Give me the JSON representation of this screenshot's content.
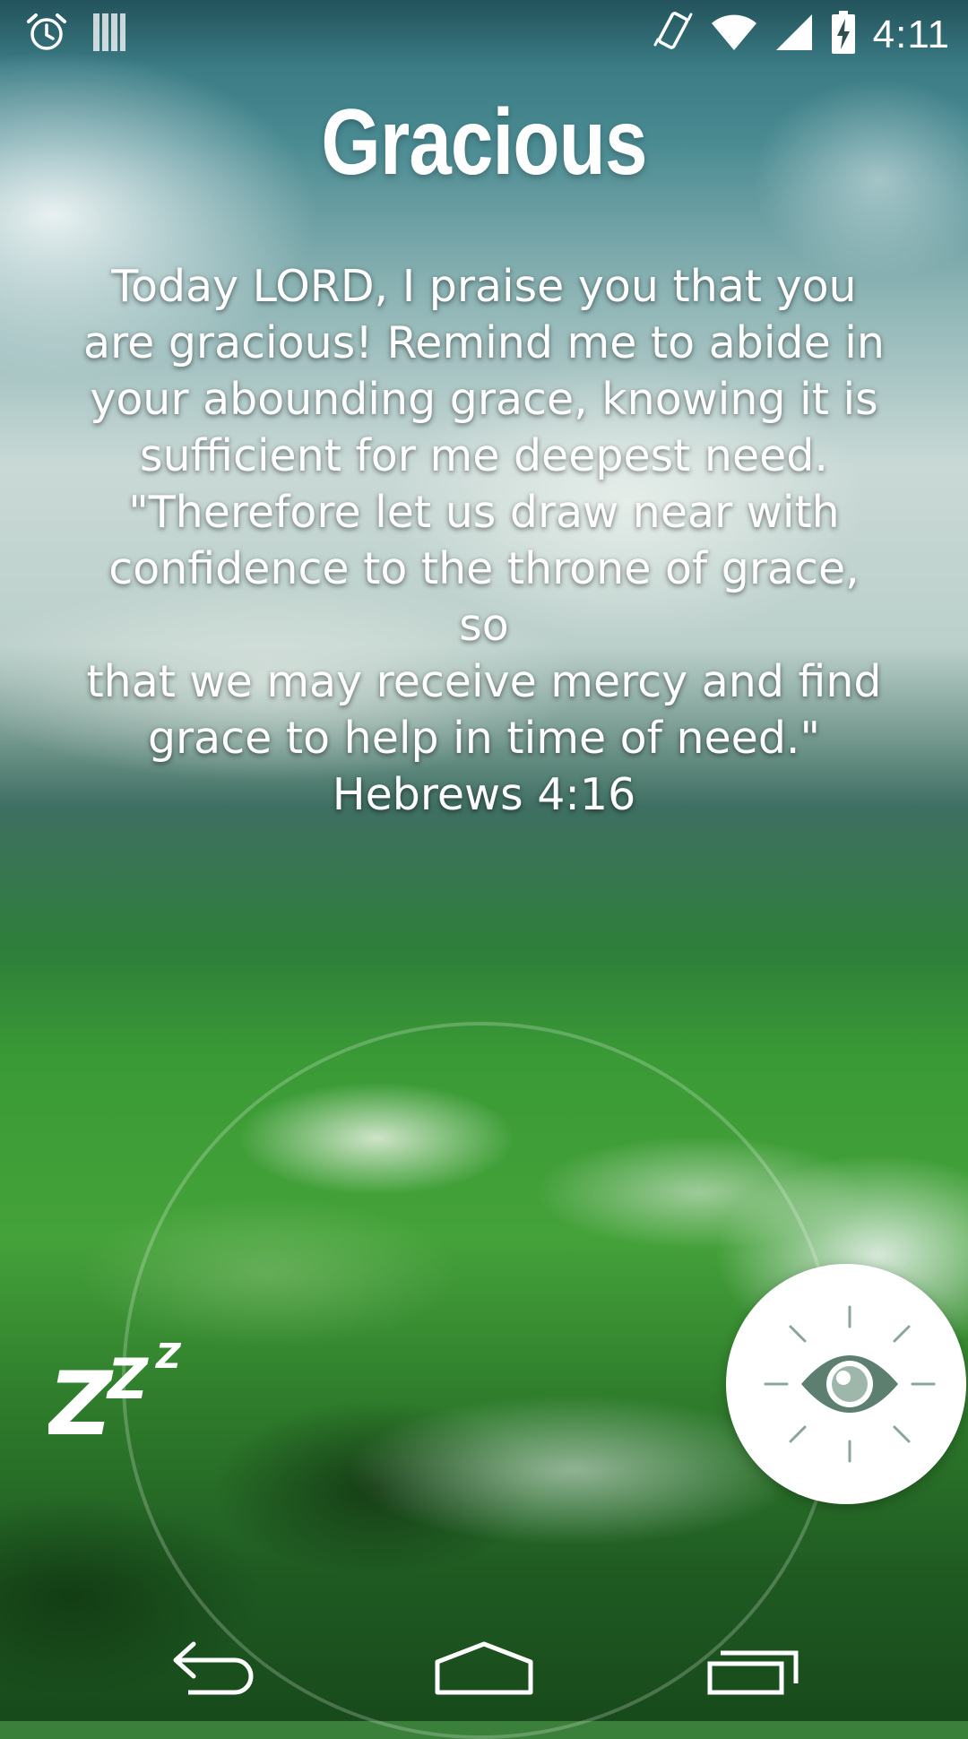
{
  "status_bar": {
    "time": "4:11",
    "left_icons": [
      "alarm-icon",
      "signal-bars-icon"
    ],
    "right_icons": [
      "vibrate-icon",
      "wifi-icon",
      "cell-signal-icon",
      "battery-charging-icon"
    ]
  },
  "content": {
    "title": "Gracious",
    "verse_lines": [
      "Today LORD, I praise you that you",
      "are gracious! Remind me to abide in",
      "your abounding grace, knowing it is",
      "sufficient for me deepest need.",
      "\"Therefore let us draw near with",
      "confidence to the throne of grace, so",
      "that we may receive mercy and find",
      "grace to help in time of need.\""
    ],
    "reference": "Hebrews 4:16"
  },
  "lockscreen": {
    "snooze_icon": "snooze-zzz-icon",
    "dismiss_icon": "eye-icon"
  },
  "nav_bar": {
    "back_icon": "back-icon",
    "home_icon": "home-icon",
    "recents_icon": "recents-icon"
  }
}
